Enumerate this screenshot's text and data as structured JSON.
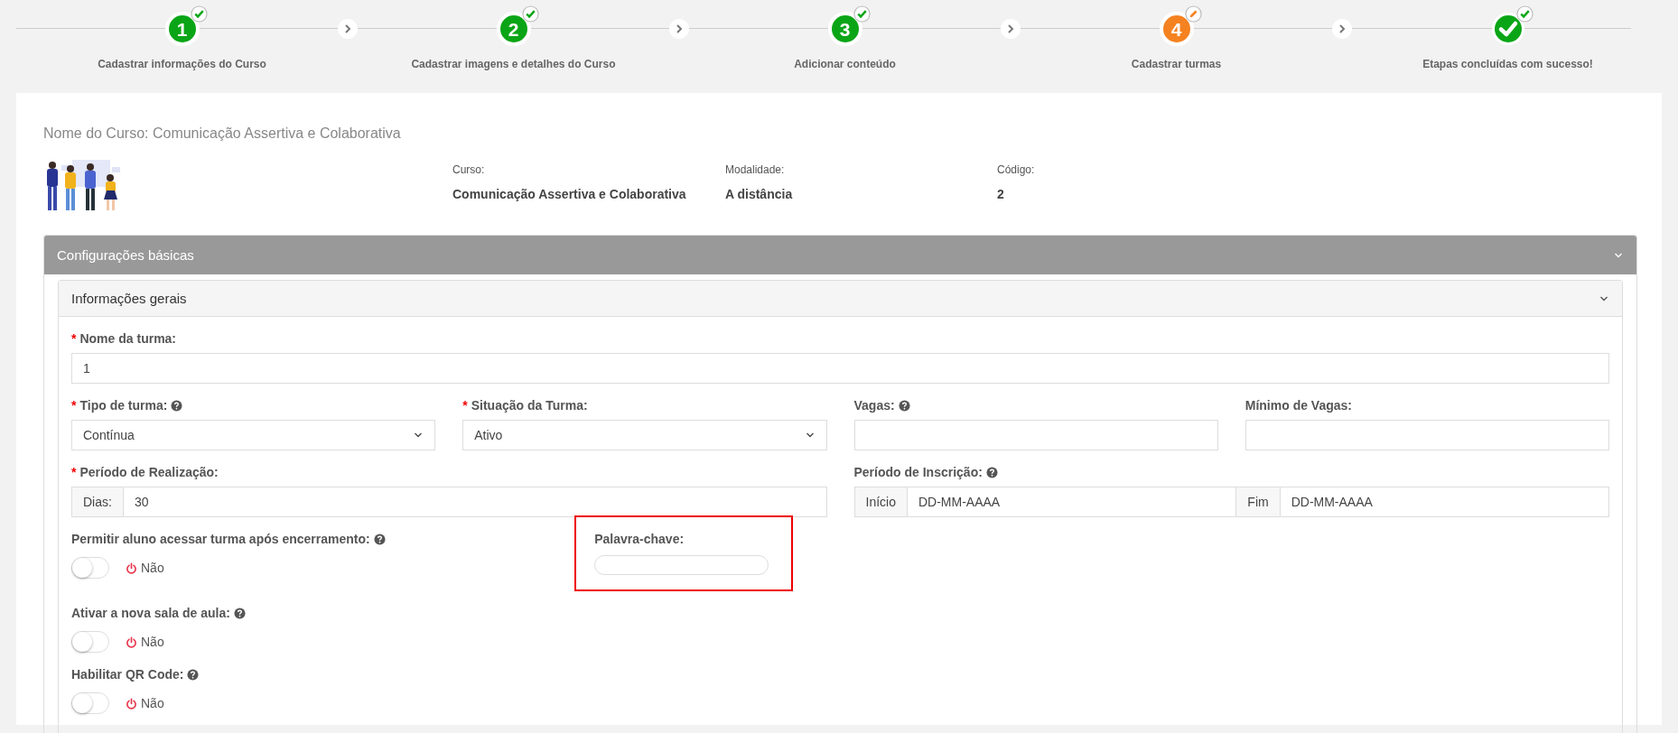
{
  "steps": [
    {
      "kind": "done",
      "number": "1",
      "label": "Cadastrar informações do Curso"
    },
    {
      "kind": "done",
      "number": "2",
      "label": "Cadastrar imagens e detalhes do Curso"
    },
    {
      "kind": "done",
      "number": "3",
      "label": "Adicionar conteúdo"
    },
    {
      "kind": "current",
      "number": "4",
      "label": "Cadastrar turmas"
    },
    {
      "kind": "final",
      "label": "Etapas concluídas com sucesso!"
    }
  ],
  "course": {
    "title": "Nome do Curso: Comunicação Assertiva e Colaborativa",
    "info": [
      {
        "label": "Curso:",
        "value": "Comunicação Assertiva e Colaborativa"
      },
      {
        "label": "Modalidade:",
        "value": "A distância"
      },
      {
        "label": "Código:",
        "value": "2"
      }
    ]
  },
  "panel": {
    "title": "Configurações básicas",
    "subpanel": {
      "title": "Informações gerais",
      "fields": [
        {
          "kind": "text",
          "required_mark": "*",
          "label": "Nome da turma:",
          "value": "1"
        },
        {
          "kind": "select",
          "required_mark": "*",
          "label": "Tipo de turma:",
          "help": true,
          "value": "Contínua"
        },
        {
          "kind": "select",
          "required_mark": "*",
          "label": "Situação da Turma:",
          "value": "Ativo"
        },
        {
          "kind": "input",
          "label": "Vagas:",
          "help": true
        },
        {
          "kind": "input",
          "label": "Mínimo de Vagas:"
        },
        {
          "kind": "addon",
          "required_mark": "*",
          "label": "Período de Realização:",
          "addon": "Dias:",
          "value": "30"
        },
        {
          "kind": "range",
          "label": "Período de Inscrição:",
          "help": true,
          "start_addon": "Início",
          "start": "DD-MM-AAAA",
          "end_addon": "Fim",
          "end": "DD-MM-AAAA"
        },
        {
          "kind": "toggle",
          "label": "Permitir aluno acessar turma após encerramento:",
          "help": true,
          "on": false,
          "state_label": "Não"
        },
        {
          "kind": "keyword",
          "label": "Palavra-chave:",
          "highlighted": true
        },
        {
          "kind": "toggle",
          "label": "Ativar a nova sala de aula:",
          "help": true,
          "on": false,
          "state_label": "Não"
        },
        {
          "kind": "toggle",
          "label": "Habilitar QR Code:",
          "help": true,
          "on": false,
          "state_label": "Não"
        }
      ]
    }
  }
}
